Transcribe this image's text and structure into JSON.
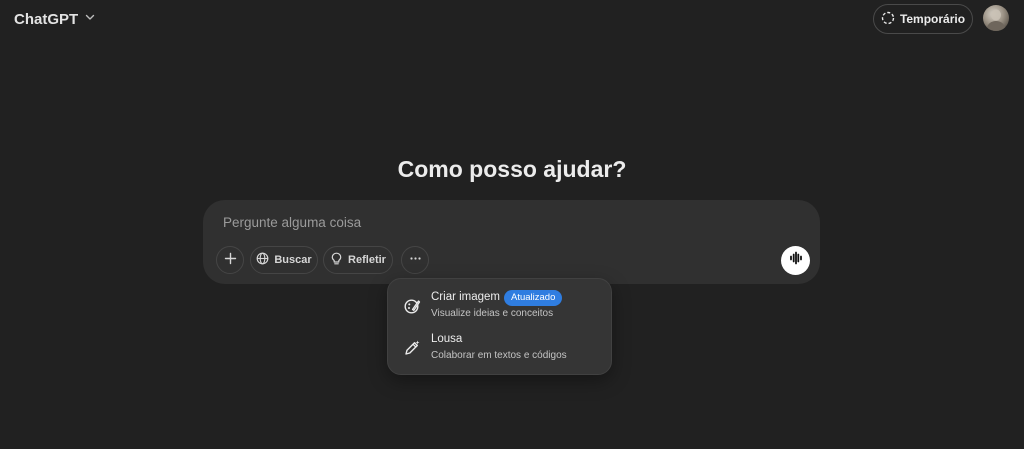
{
  "header": {
    "model_name": "ChatGPT",
    "temporary_label": "Temporário"
  },
  "main": {
    "heading": "Como posso ajudar?"
  },
  "composer": {
    "placeholder": "Pergunte alguma coisa",
    "tools": {
      "search_label": "Buscar",
      "think_label": "Refletir"
    }
  },
  "menu": {
    "items": [
      {
        "title": "Criar imagem",
        "badge": "Atualizado",
        "description": "Visualize ideias e conceitos",
        "icon": "image-create-icon"
      },
      {
        "title": "Lousa",
        "description": "Colaborar em textos e códigos",
        "icon": "canvas-pen-icon"
      }
    ]
  },
  "colors": {
    "background": "#212121",
    "composer": "#303030",
    "menu": "#353535",
    "badge": "#2f7de0",
    "text": "#ececec"
  }
}
